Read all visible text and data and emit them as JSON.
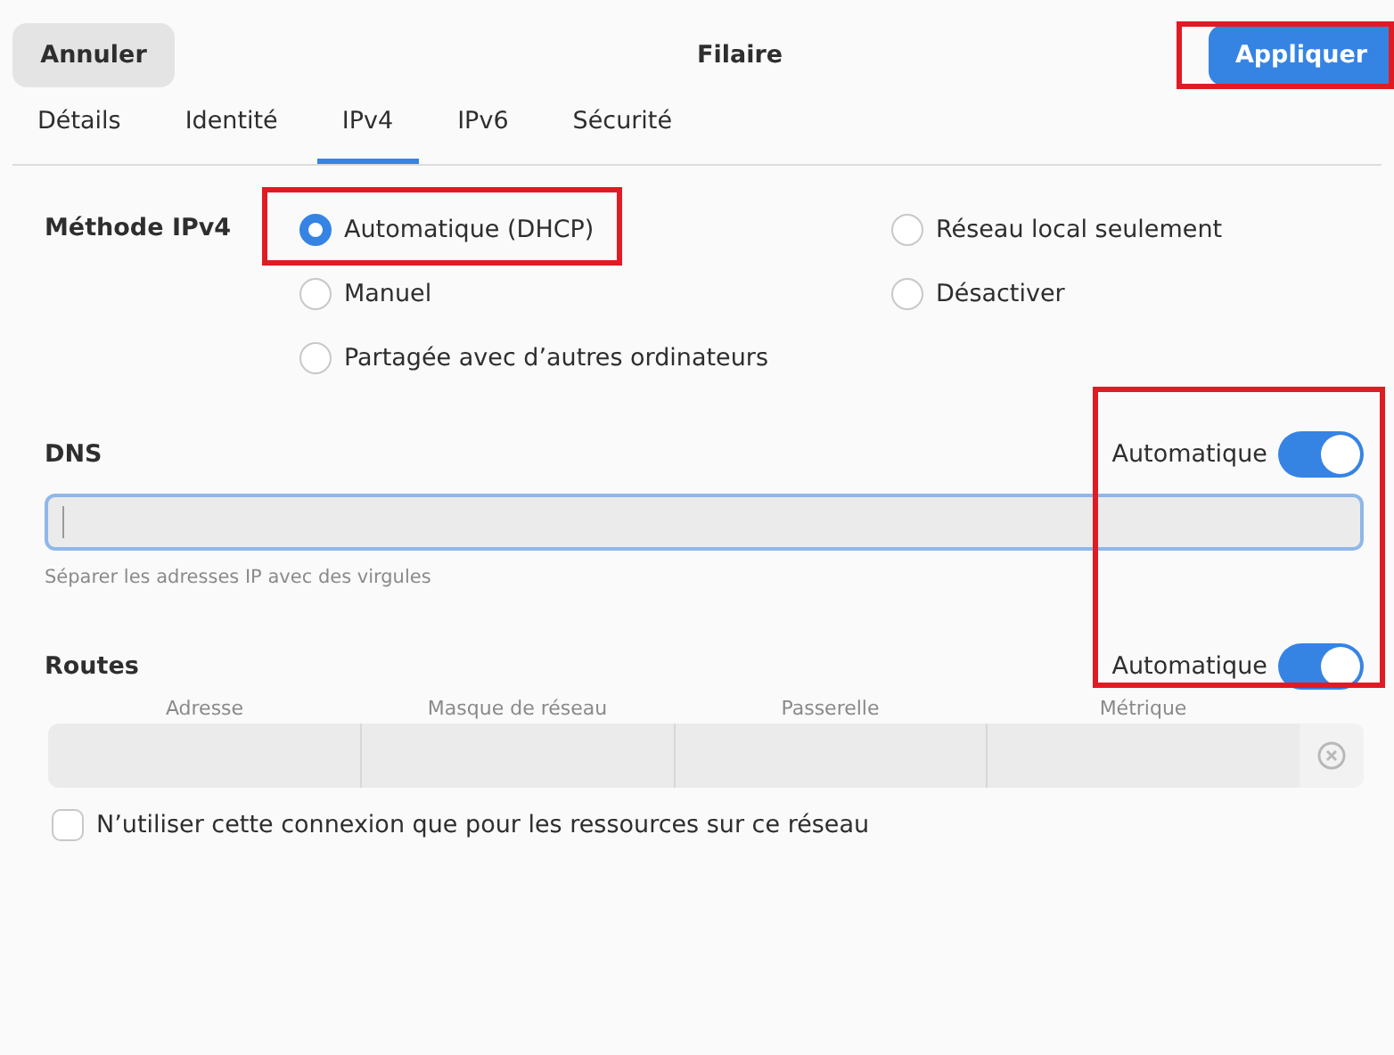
{
  "header": {
    "cancel_button": "Annuler",
    "title": "Filaire",
    "apply_button": {
      "label": "Appliquer",
      "highlighted": true
    }
  },
  "tabs": [
    {
      "label": "Détails",
      "selected": false
    },
    {
      "label": "Identité",
      "selected": false
    },
    {
      "label": "IPv4",
      "selected": true
    },
    {
      "label": "IPv6",
      "selected": false
    },
    {
      "label": "Sécurité",
      "selected": false
    }
  ],
  "method": {
    "label": "Méthode IPv4",
    "options": [
      {
        "label": "Automatique (DHCP)",
        "selected": true,
        "highlighted": true
      },
      {
        "label": "Réseau local seulement",
        "selected": false,
        "highlighted": false
      },
      {
        "label": "Manuel",
        "selected": false,
        "highlighted": false
      },
      {
        "label": "Désactiver",
        "selected": false,
        "highlighted": false
      },
      {
        "label": "Partagée avec d’autres ordinateurs",
        "selected": false,
        "highlighted": false
      }
    ]
  },
  "switches_highlighted": true,
  "dns": {
    "label": "DNS",
    "switch_label": "Automatique",
    "on": true,
    "hint": "Séparer les adresses IP avec des virgules"
  },
  "routes": {
    "label": "Routes",
    "switch_label": "Automatique",
    "on": true,
    "columns": [
      "Adresse",
      "Masque de réseau",
      "Passerelle",
      "Métrique"
    ]
  },
  "restrict": {
    "label": "N’utiliser cette connexion que pour les ressources sur ce réseau",
    "checked": false
  }
}
